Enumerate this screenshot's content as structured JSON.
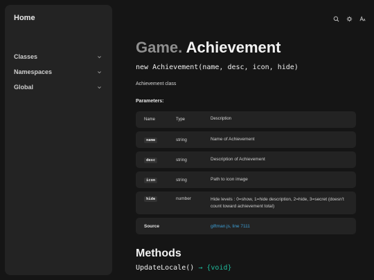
{
  "sidebar": {
    "home": "Home",
    "items": [
      {
        "label": "Classes"
      },
      {
        "label": "Namespaces"
      },
      {
        "label": "Global"
      }
    ]
  },
  "toolbar": {
    "icons": [
      "search-icon",
      "gear-icon",
      "font-size-icon"
    ]
  },
  "page": {
    "namespace": "Game.",
    "name": "Achievement",
    "signature": "new Achievement(name, desc, icon, hide)",
    "description": "Achievement class",
    "params_label": "Parameters:"
  },
  "params": {
    "headers": {
      "name": "Name",
      "type": "Type",
      "description": "Description"
    },
    "rows": [
      {
        "name": "name",
        "type": "string",
        "description": "Name of Achievement"
      },
      {
        "name": "desc",
        "type": "string",
        "description": "Description of Achievement"
      },
      {
        "name": "icon",
        "type": "string",
        "description": "Path to icon image"
      },
      {
        "name": "hide",
        "type": "number",
        "description": "Hide levels : 0=show, 1=hide description, 2=hide, 3=secret (doesn't count toward achievement total)"
      }
    ]
  },
  "source": {
    "label": "Source",
    "link": "giftman.js, line 7111"
  },
  "methods": {
    "heading": "Methods",
    "items": [
      {
        "name": "UpdateLocale()",
        "arrow": "→",
        "returns": "{void}"
      }
    ]
  },
  "colors": {
    "background": "#151515",
    "panel": "#232323",
    "link": "#3d9fd6",
    "return_type": "#1fb89a",
    "namespace": "#8f8f8f"
  }
}
